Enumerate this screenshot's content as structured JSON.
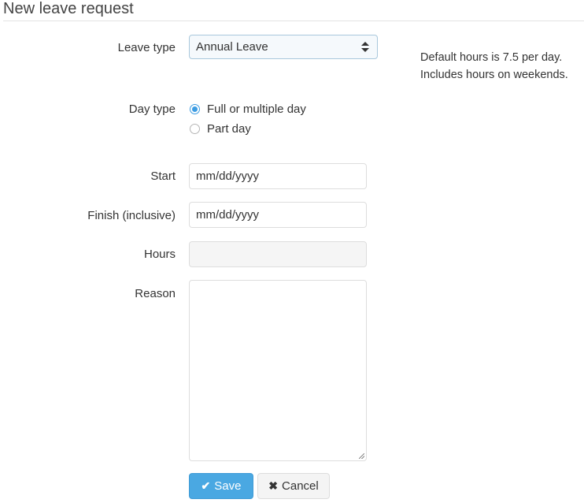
{
  "page": {
    "title": "New leave request"
  },
  "form": {
    "leave_type": {
      "label": "Leave type",
      "value": "Annual Leave"
    },
    "help_text": {
      "line1": "Default hours is 7.5 per day.",
      "line2": "Includes hours on weekends."
    },
    "day_type": {
      "label": "Day type",
      "options": [
        {
          "label": "Full or multiple day",
          "checked": true
        },
        {
          "label": "Part day",
          "checked": false
        }
      ]
    },
    "start": {
      "label": "Start",
      "placeholder": "mm/dd/yyyy"
    },
    "finish": {
      "label": "Finish (inclusive)",
      "placeholder": "mm/dd/yyyy"
    },
    "hours": {
      "label": "Hours",
      "value": ""
    },
    "reason": {
      "label": "Reason",
      "value": ""
    }
  },
  "actions": {
    "save": {
      "label": "Save",
      "icon": "✔"
    },
    "cancel": {
      "label": "Cancel",
      "icon": "✖"
    }
  },
  "colors": {
    "primary": "#4aa8e2",
    "radio_accent": "#3d9ce2"
  }
}
